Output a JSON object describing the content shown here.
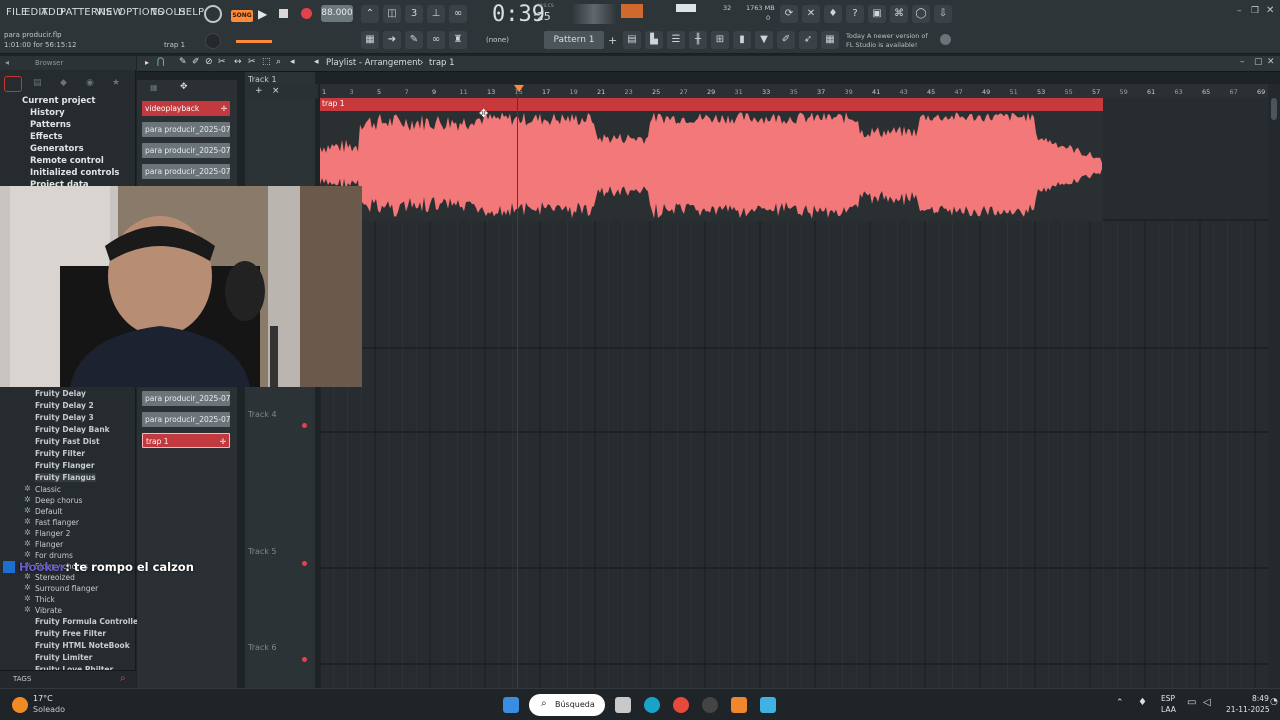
{
  "menus": [
    "FILE",
    "EDIT",
    "ADD",
    "PATTERNS",
    "VIEW",
    "OPTIONS",
    "TOOLS",
    "HELP"
  ],
  "project": {
    "file": "para producir.flp",
    "time": "1:01:00 for 56:15:12",
    "channel": "trap 1"
  },
  "transport": {
    "song_mode": "SONG",
    "tempo": "88.000",
    "time_display": "0:39",
    "time_small": ":25",
    "time_unit": "M:S:CS"
  },
  "perf": {
    "cpu": "32",
    "mem": "1763 MB",
    "poly": "0"
  },
  "pattern": {
    "snap": "(none)",
    "name": "Pattern 1"
  },
  "news": {
    "line1": "Today  A newer version of",
    "line2": "FL Studio is available!"
  },
  "playlist": {
    "title": "Playlist - Arrangement",
    "crumb": "trap 1",
    "track1": "Track 1",
    "track4": "Track 4",
    "track5": "Track 5",
    "track6": "Track 6",
    "clip_label": "trap 1"
  },
  "browser": {
    "title": "Browser",
    "tree": [
      "Current project",
      "History",
      "Patterns",
      "Effects",
      "Generators",
      "Remote control",
      "Initialized controls",
      "Project data"
    ],
    "plugins_top": [
      "Fruity Delay",
      "Fruity Delay 2",
      "Fruity Delay 3",
      "Fruity Delay Bank",
      "Fruity Fast Dist",
      "Fruity Filter",
      "Fruity Flanger",
      "Fruity Flangus"
    ],
    "presets": [
      "Classic",
      "Deep chorus",
      "Default",
      "Fast flanger",
      "Flanger 2",
      "Flanger",
      "For drums",
      "Sloppy chorus",
      "Stereoized",
      "Surround flanger",
      "Thick",
      "Vibrate"
    ],
    "plugins_bottom": [
      "Fruity Formula Controller",
      "Fruity Free Filter",
      "Fruity HTML NoteBook",
      "Fruity Limiter",
      "Fruity Love Philter"
    ],
    "tags": "TAGS"
  },
  "picker": {
    "top": [
      {
        "label": "videoplayback",
        "red": true
      },
      {
        "label": "para producir_2025-07-...",
        "red": false
      },
      {
        "label": "para producir_2025-07-...",
        "red": false
      },
      {
        "label": "para producir_2025-07-...",
        "red": false
      }
    ],
    "bottom": [
      {
        "label": "para producir_2025-07-...",
        "red": false
      },
      {
        "label": "para producir_2025-07-...",
        "red": false
      },
      {
        "label": "trap 1",
        "red": true
      }
    ]
  },
  "ruler": [
    "1",
    "3",
    "5",
    "7",
    "9",
    "11",
    "13",
    "15",
    "17",
    "19",
    "21",
    "23",
    "25",
    "27",
    "29",
    "31",
    "33",
    "35",
    "37",
    "39",
    "41",
    "43",
    "45",
    "47",
    "49",
    "51",
    "53",
    "55",
    "57",
    "59",
    "61",
    "63",
    "65",
    "67",
    "69"
  ],
  "chat": {
    "user": "Hooker",
    "message": ": te rompo el calzon"
  },
  "taskbar": {
    "temp": "17°C",
    "weather": "Soleado",
    "search": "Búsqueda",
    "lang1": "ESP",
    "lang2": "LAA",
    "clock": "8:49",
    "date": "21-11-2025"
  },
  "colors": {
    "clip": "#f2787a",
    "clip_header": "#c7393d",
    "accent": "#ff8a3a"
  }
}
